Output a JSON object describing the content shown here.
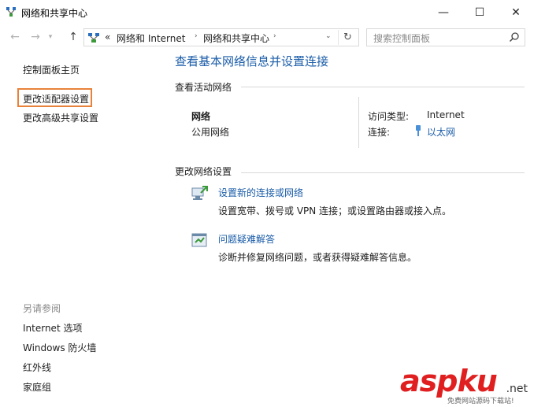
{
  "window": {
    "title": "网络和共享中心",
    "minimize": "—",
    "maximize": "☐",
    "close": "✕"
  },
  "address": {
    "prefix": "«",
    "crumbs": [
      "网络和 Internet",
      "网络和共享中心"
    ],
    "search_placeholder": "搜索控制面板"
  },
  "sidebar": {
    "home": "控制面板主页",
    "adapter": "更改适配器设置",
    "advanced": "更改高级共享设置",
    "see_also_header": "另请参阅",
    "see_also": [
      "Internet 选项",
      "Windows 防火墙",
      "红外线",
      "家庭组"
    ]
  },
  "main": {
    "title": "查看基本网络信息并设置连接",
    "active_header": "查看活动网络",
    "network_name": "网络",
    "network_type": "公用网络",
    "access_label": "访问类型:",
    "access_value": "Internet",
    "conn_label": "连接:",
    "conn_value": "以太网",
    "change_header": "更改网络设置",
    "tasks": [
      {
        "link": "设置新的连接或网络",
        "desc": "设置宽带、拨号或 VPN 连接；或设置路由器或接入点。"
      },
      {
        "link": "问题疑难解答",
        "desc": "诊断并修复网络问题，或者获得疑难解答信息。"
      }
    ]
  },
  "watermark": {
    "brand": "aspku",
    "tld": ".net",
    "sub": "免费网站源码下载站!"
  },
  "colors": {
    "link": "#1a5ca8",
    "highlight": "#e8823a",
    "watermark": "#e02020"
  }
}
